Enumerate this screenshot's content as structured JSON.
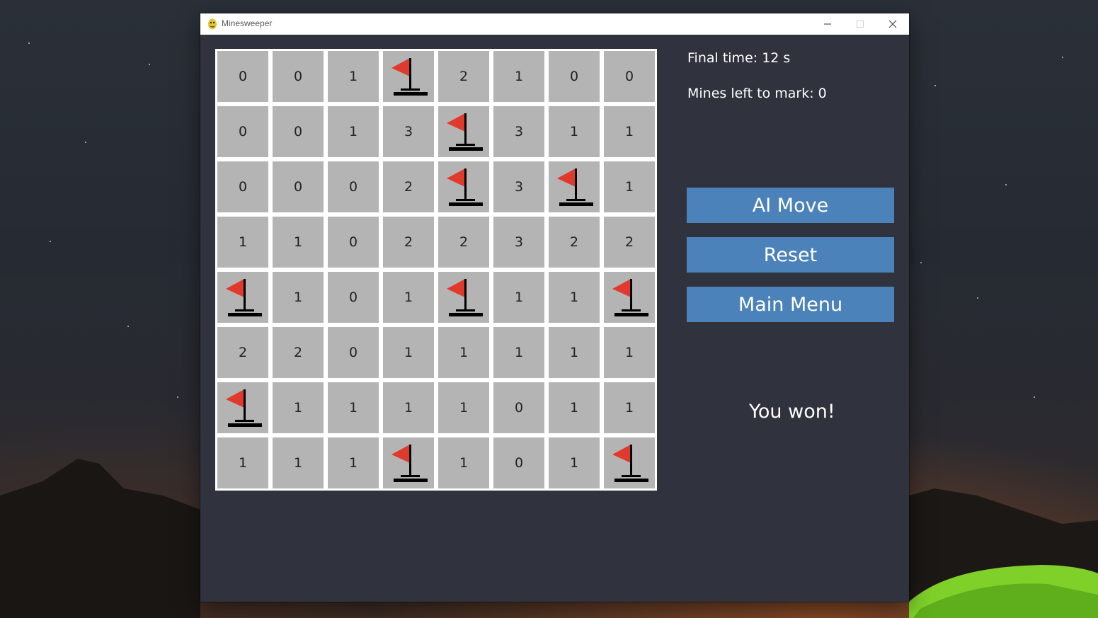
{
  "window": {
    "title": "Minesweeper"
  },
  "status": {
    "final_time": "Final time: 12 s",
    "mines_left": "Mines left to mark: 0"
  },
  "buttons": {
    "ai_move": "AI Move",
    "reset": "Reset",
    "main_menu": "Main Menu"
  },
  "result": "You won!",
  "board": {
    "rows": [
      [
        "0",
        "0",
        "1",
        "F",
        "2",
        "1",
        "0",
        "0"
      ],
      [
        "0",
        "0",
        "1",
        "3",
        "F",
        "3",
        "1",
        "1"
      ],
      [
        "0",
        "0",
        "0",
        "2",
        "F",
        "3",
        "F",
        "1"
      ],
      [
        "1",
        "1",
        "0",
        "2",
        "2",
        "3",
        "2",
        "2"
      ],
      [
        "F",
        "1",
        "0",
        "1",
        "F",
        "1",
        "1",
        "F"
      ],
      [
        "2",
        "2",
        "0",
        "1",
        "1",
        "1",
        "1",
        "1"
      ],
      [
        "F",
        "1",
        "1",
        "1",
        "1",
        "0",
        "1",
        "1"
      ],
      [
        "1",
        "1",
        "1",
        "F",
        "1",
        "0",
        "1",
        "F"
      ]
    ]
  },
  "colors": {
    "window_bg": "#30323e",
    "cell_bg": "#b4b4b4",
    "button_bg": "#4b82b9",
    "flag_red": "#e03a2c"
  }
}
